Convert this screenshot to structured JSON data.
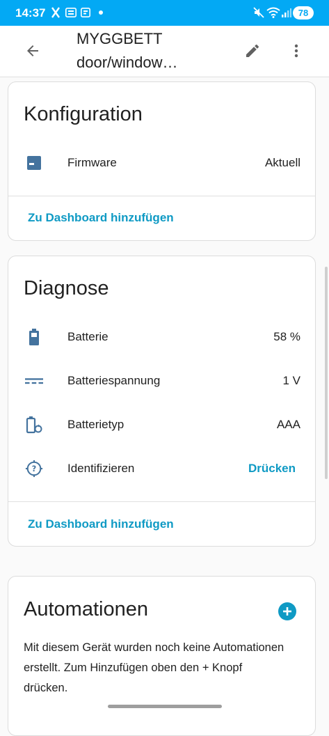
{
  "status_bar": {
    "time": "14:37",
    "battery": "78",
    "accent": "#03a9f4"
  },
  "app_bar": {
    "title_line1": "MYGGBETT",
    "title_line2": "door/window…"
  },
  "config_card": {
    "title": "Konfiguration",
    "rows": [
      {
        "icon": "firmware-icon",
        "label": "Firmware",
        "value": "Aktuell"
      }
    ],
    "link": "Zu Dashboard hinzufügen"
  },
  "diag_card": {
    "title": "Diagnose",
    "rows": [
      {
        "icon": "battery-icon",
        "label": "Batterie",
        "value": "58 %"
      },
      {
        "icon": "dc-voltage-icon",
        "label": "Batteriespannung",
        "value": "1 V"
      },
      {
        "icon": "battery-sync-icon",
        "label": "Batterietyp",
        "value": "AAA"
      },
      {
        "icon": "identify-icon",
        "label": "Identifizieren",
        "action": "Drücken"
      }
    ],
    "link": "Zu Dashboard hinzufügen"
  },
  "auto_card": {
    "title": "Automationen",
    "description": "Mit diesem Gerät wurden noch keine Automationen erstellt. Zum Hinzufügen oben den + Knopf drücken."
  },
  "colors": {
    "link": "#0f9ac4",
    "icon": "#44739e"
  }
}
